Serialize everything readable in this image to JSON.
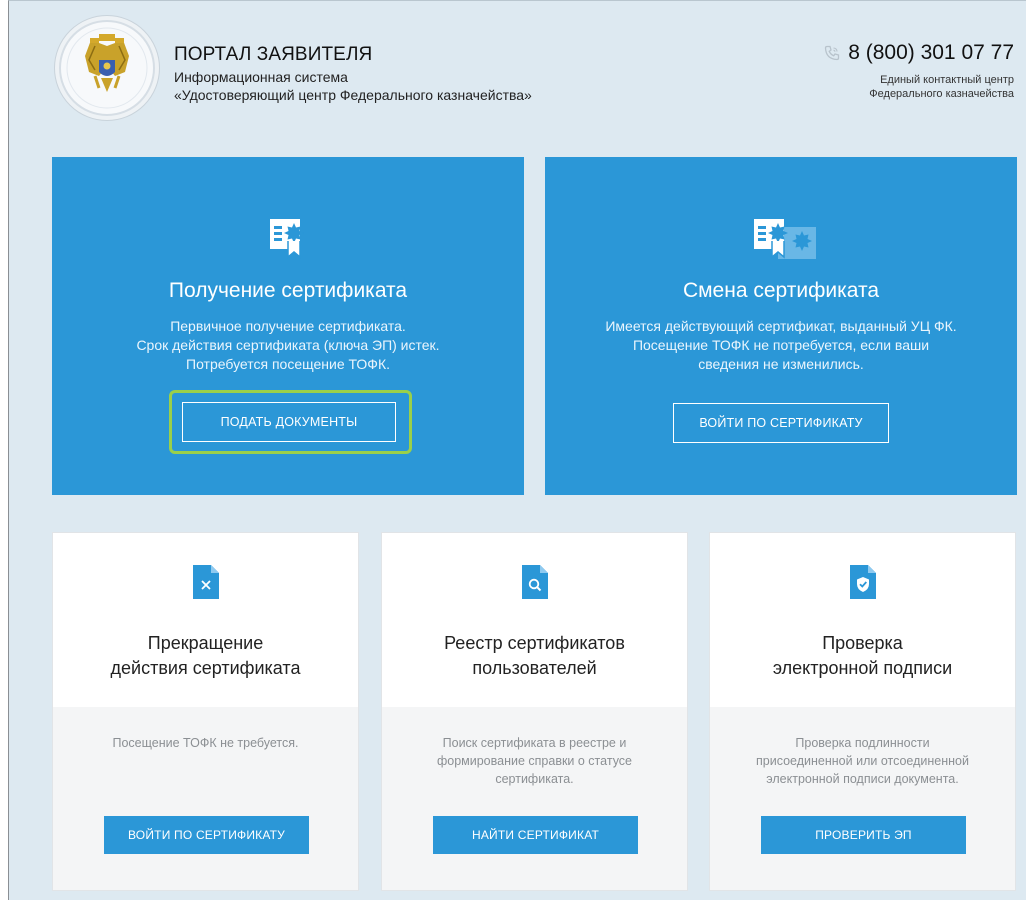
{
  "header": {
    "title": "ПОРТАЛ ЗАЯВИТЕЛЯ",
    "subtitle_line1": "Информационная система",
    "subtitle_line2": "«Удостоверяющий центр Федерального казначейства»",
    "phone": "8 (800) 301 07 77",
    "contact_line1": "Единый контактный центр",
    "contact_line2": "Федерального казначейства",
    "logo_icon": "treasury-emblem-icon",
    "phone_icon": "phone-icon"
  },
  "cards": {
    "obtain": {
      "title": "Получение сертификата",
      "desc": [
        "Первичное получение сертификата.",
        "Срок действия сертификата (ключа ЭП) истек.",
        "Потребуется посещение ТОФК."
      ],
      "button": "ПОДАТЬ ДОКУМЕНТЫ",
      "icon": "certificate-icon"
    },
    "change": {
      "title": "Смена сертификата",
      "desc": [
        "Имеется действующий сертификат, выданный УЦ ФК.",
        "Посещение ТОФК не потребуется, если ваши",
        "сведения не изменились."
      ],
      "button": "ВОЙТИ ПО СЕРТИФИКАТУ",
      "icon": "certificate-change-icon"
    },
    "revoke": {
      "title_line1": "Прекращение",
      "title_line2": "действия сертификата",
      "desc": [
        "Посещение ТОФК не требуется."
      ],
      "button": "ВОЙТИ ПО СЕРТИФИКАТУ",
      "icon": "file-cancel-icon"
    },
    "registry": {
      "title_line1": "Реестр сертификатов",
      "title_line2": "пользователей",
      "desc": [
        "Поиск сертификата в реестре и",
        "формирование справки о статусе",
        "сертификата."
      ],
      "button": "НАЙТИ СЕРТИФИКАТ",
      "icon": "file-search-icon"
    },
    "verify": {
      "title_line1": "Проверка",
      "title_line2": "электронной подписи",
      "desc": [
        "Проверка подлинности",
        "присоединенной или отсоединенной",
        "электронной подписи документа."
      ],
      "button": "ПРОВЕРИТЬ ЭП",
      "icon": "file-shield-icon"
    }
  },
  "colors": {
    "accent": "#2b97d7",
    "background": "#dde9f1",
    "focus_ring": "#9ad04a"
  }
}
